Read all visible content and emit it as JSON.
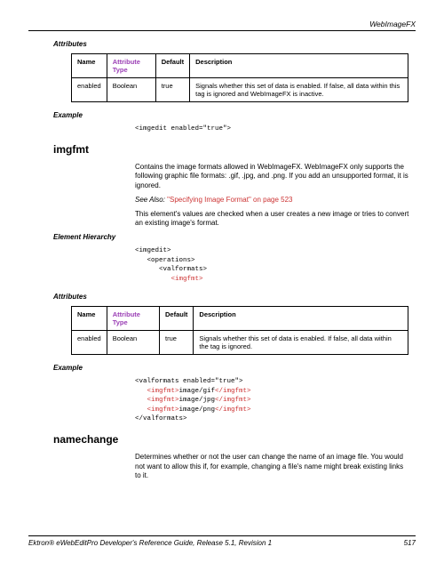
{
  "header": {
    "right": "WebImageFX"
  },
  "attributes_label": "Attributes",
  "example_label": "Example",
  "element_hierarchy_label": "Element Hierarchy",
  "table_headers": {
    "name": "Name",
    "attr_type": "Attribute Type",
    "default": "Default",
    "description": "Description"
  },
  "table1": {
    "row": {
      "name": "enabled",
      "attr_type": "Boolean",
      "default": "true",
      "description": "Signals whether this set of data is enabled. If false, all data within this tag is ignored and WebImageFX is inactive."
    }
  },
  "example1": "<imgedit enabled=\"true\">",
  "imgfmt": {
    "heading": "imgfmt",
    "para1": "Contains the image formats allowed in WebImageFX. WebImageFX only supports the following graphic file formats: .gif, .jpg, and .png. If you add an unsupported format, it is ignored.",
    "see_also_prefix": "See Also: ",
    "see_also_link": "\"Specifying Image Format\" on page 523",
    "para2": "This element's values are checked when a user creates a new image or tries to convert an existing image's format.",
    "hierarchy": {
      "l1": "<imgedit>",
      "l2": "   <operations>",
      "l3": "      <valformats>",
      "l4": "         <imgfmt>"
    }
  },
  "table2": {
    "row": {
      "name": "enabled",
      "attr_type": "Boolean",
      "default": "true",
      "description": "Signals whether this set of data is enabled. If false, all data within the tag is ignored."
    }
  },
  "example2": {
    "l1": "<valformats enabled=\"true\">",
    "l2a": "   <imgfmt>",
    "l2b": "image/gif",
    "l2c": "</imgfmt>",
    "l3a": "   <imgfmt>",
    "l3b": "image/jpg",
    "l3c": "</imgfmt>",
    "l4a": "   <imgfmt>",
    "l4b": "image/png",
    "l4c": "</imgfmt>",
    "l5": "</valformats>"
  },
  "namechange": {
    "heading": "namechange",
    "para": "Determines whether or not the user can change the name of an image file. You would not want to allow this if, for example, changing a file's name might break existing links to it."
  },
  "footer": {
    "left": "Ektron® eWebEditPro Developer's Reference Guide, Release 5.1, Revision 1",
    "right": "517"
  }
}
